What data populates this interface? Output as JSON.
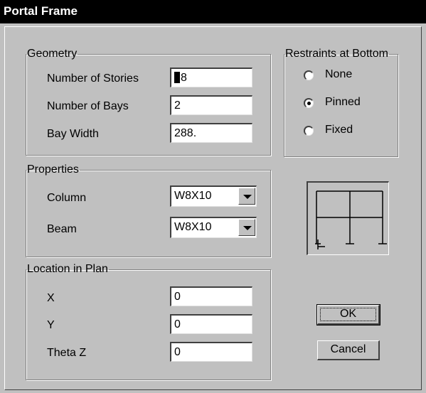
{
  "window": {
    "title": "Portal Frame"
  },
  "geometry": {
    "legend": "Geometry",
    "stories_label": "Number of Stories",
    "stories_value": "8",
    "bays_label": "Number of Bays",
    "bays_value": "2",
    "bay_width_label": "Bay Width",
    "bay_width_value": "288."
  },
  "restraints": {
    "legend": "Restraints at Bottom",
    "options": [
      {
        "label": "None",
        "checked": false
      },
      {
        "label": "Pinned",
        "checked": true
      },
      {
        "label": "Fixed",
        "checked": false
      }
    ]
  },
  "properties": {
    "legend": "Properties",
    "column_label": "Column",
    "column_value": "W8X10",
    "beam_label": "Beam",
    "beam_value": "W8X10"
  },
  "location": {
    "legend": "Location in Plan",
    "x_label": "X",
    "x_value": "0",
    "y_label": "Y",
    "y_value": "0",
    "theta_label": "Theta Z",
    "theta_value": "0"
  },
  "buttons": {
    "ok": "OK",
    "cancel": "Cancel"
  },
  "colors": {
    "dialog_bg": "#c0c0c0",
    "titlebar_bg": "#000000"
  }
}
